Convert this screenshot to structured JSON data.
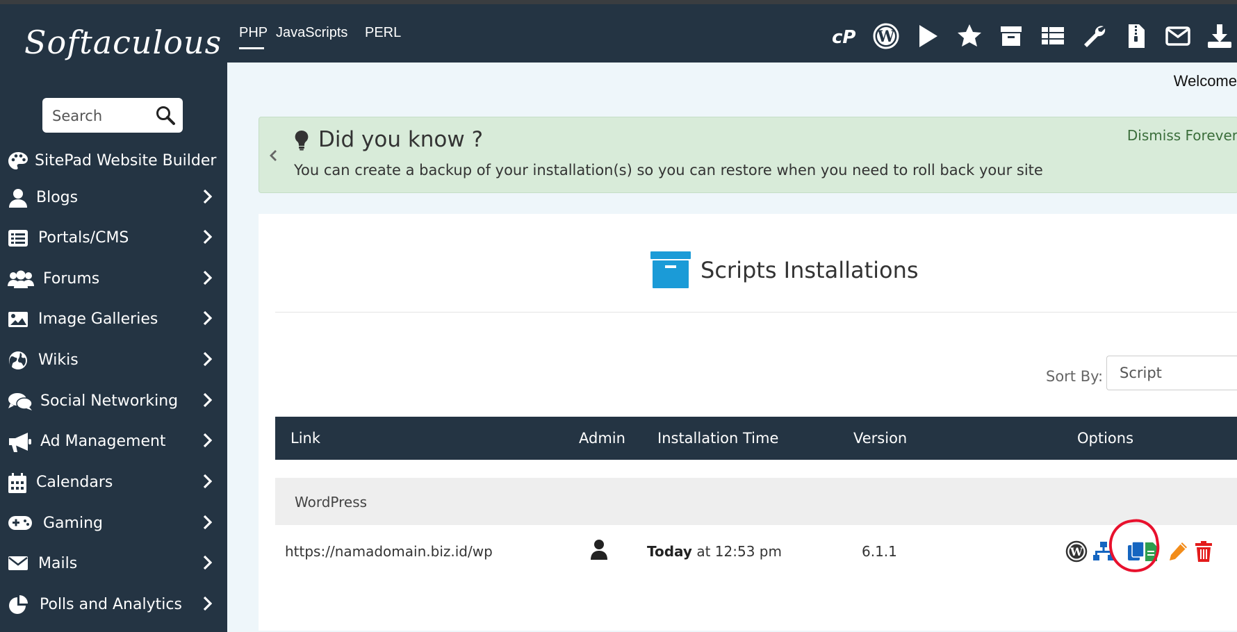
{
  "brand": {
    "logo_text": "Softaculous"
  },
  "search": {
    "placeholder": "Search"
  },
  "sidebar": {
    "items": [
      {
        "label": "SitePad Website Builder",
        "icon": "palette-icon",
        "has_chevron": false
      },
      {
        "label": "Blogs",
        "icon": "user-icon",
        "has_chevron": true
      },
      {
        "label": "Portals/CMS",
        "icon": "list-icon",
        "has_chevron": true
      },
      {
        "label": "Forums",
        "icon": "users-icon",
        "has_chevron": true
      },
      {
        "label": "Image Galleries",
        "icon": "image-icon",
        "has_chevron": true
      },
      {
        "label": "Wikis",
        "icon": "globe-icon",
        "has_chevron": true
      },
      {
        "label": "Social Networking",
        "icon": "comments-icon",
        "has_chevron": true
      },
      {
        "label": "Ad Management",
        "icon": "bullhorn-icon",
        "has_chevron": true
      },
      {
        "label": "Calendars",
        "icon": "calendar-icon",
        "has_chevron": true
      },
      {
        "label": "Gaming",
        "icon": "gamepad-icon",
        "has_chevron": true
      },
      {
        "label": "Mails",
        "icon": "envelope-icon",
        "has_chevron": true
      },
      {
        "label": "Polls and Analytics",
        "icon": "pie-chart-icon",
        "has_chevron": true
      }
    ]
  },
  "topbar": {
    "tabs": [
      "PHP",
      "JavaScripts",
      "PERL"
    ],
    "active_tab": "PHP",
    "icons": [
      "cpanel-icon",
      "wordpress-icon",
      "play-icon",
      "star-icon",
      "archive-icon",
      "table-list-icon",
      "wrench-icon",
      "file-zip-icon",
      "envelope-icon",
      "download-icon"
    ]
  },
  "main": {
    "welcome": "Welcome"
  },
  "tip": {
    "title": "Did you know ?",
    "message": "You can create a backup of your installation(s) so you can restore when you need to roll back your site",
    "dismiss": "Dismiss Forever"
  },
  "installations": {
    "title": "Scripts Installations",
    "sort_label": "Sort By:",
    "sort_value": "Script",
    "columns": [
      "Link",
      "Admin",
      "Installation Time",
      "Version",
      "Options"
    ],
    "group": "WordPress",
    "rows": [
      {
        "link": "https://namadomain.biz.id/wp",
        "time_bold": "Today",
        "time_rest": " at 12:53 pm",
        "version": "6.1.1"
      }
    ]
  },
  "colors": {
    "sidebar_bg": "#243443",
    "accent_blue": "#1b9bd7",
    "option_blue": "#1565c0",
    "edit_orange": "#f28c1a",
    "delete_red": "#e31b1b",
    "annotation_red": "#e8112d"
  }
}
